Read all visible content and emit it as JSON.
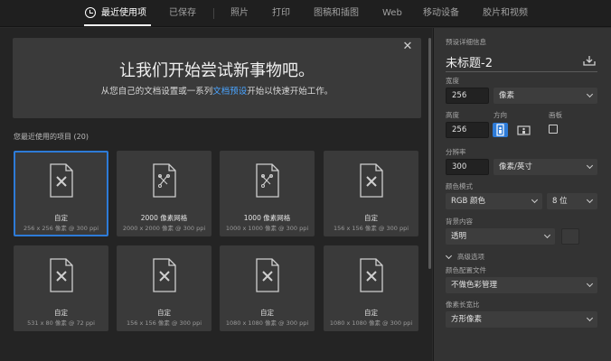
{
  "tabs": [
    {
      "label": "最近使用项",
      "active": true
    },
    {
      "label": "已保存"
    },
    {
      "label": "照片"
    },
    {
      "label": "打印"
    },
    {
      "label": "图稿和插图"
    },
    {
      "label": "Web"
    },
    {
      "label": "移动设备"
    },
    {
      "label": "胶片和视频"
    }
  ],
  "hero": {
    "title": "让我们开始尝试新事物吧。",
    "sub_before": "从您自己的文档设置或一系列",
    "sub_link": "文档预设",
    "sub_after": "开始以快速开始工作。",
    "close": "✕"
  },
  "recent": {
    "label": "您最近使用的项目 (20)",
    "items": [
      {
        "name": "自定",
        "meta": "256 x 256 像素 @ 300 ppi",
        "icon": "custom-document-icon"
      },
      {
        "name": "2000 像素网格",
        "meta": "2000 x 2000 像素 @ 300 ppi",
        "icon": "pen-document-icon"
      },
      {
        "name": "1000 像素网格",
        "meta": "1000 x 1000 像素 @ 300 ppi",
        "icon": "pen-document-icon"
      },
      {
        "name": "自定",
        "meta": "156 x 156 像素 @ 300 ppi",
        "icon": "custom-document-icon"
      },
      {
        "name": "自定",
        "meta": "531 x 80 像素 @ 72 ppi",
        "icon": "custom-document-icon"
      },
      {
        "name": "自定",
        "meta": "156 x 156 像素 @ 300 ppi",
        "icon": "custom-document-icon"
      },
      {
        "name": "自定",
        "meta": "1080 x 1080 像素 @ 300 ppi",
        "icon": "custom-document-icon"
      },
      {
        "name": "自定",
        "meta": "1080 x 1080 像素 @ 300 ppi",
        "icon": "custom-document-icon"
      }
    ]
  },
  "details": {
    "section_label": "预设详细信息",
    "doc_name": "未标题-2",
    "width_label": "宽度",
    "width_value": "256",
    "width_unit": "像素",
    "height_label": "高度",
    "height_value": "256",
    "orientation_label": "方向",
    "artboard_label": "画板",
    "resolution_label": "分辨率",
    "resolution_value": "300",
    "resolution_unit": "像素/英寸",
    "color_mode_label": "颜色模式",
    "color_mode_value": "RGB 颜色",
    "bit_depth_value": "8 位",
    "background_label": "背景内容",
    "background_value": "透明",
    "advanced_label": "高级选项",
    "color_profile_label": "颜色配置文件",
    "color_profile_value": "不做色彩管理",
    "pixel_aspect_label": "像素长宽比",
    "pixel_aspect_value": "方形像素"
  },
  "colors": {
    "accent": "#2d7bd8",
    "link": "#4aa4ff"
  }
}
